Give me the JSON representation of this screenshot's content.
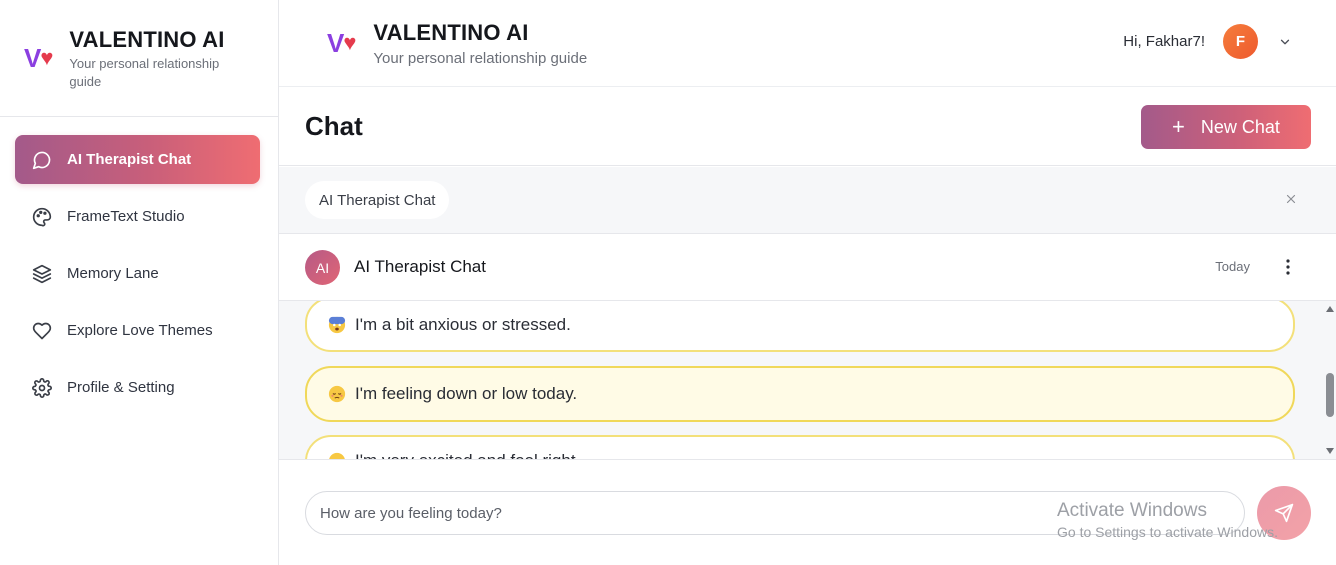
{
  "brand": {
    "logo_v": "V",
    "logo_heart": "♥",
    "title": "VALENTINO AI",
    "subtitle": "Your personal relationship guide"
  },
  "sidebar": {
    "items": [
      {
        "label": "AI Therapist Chat",
        "icon": "chat-bubble-icon",
        "active": true
      },
      {
        "label": "FrameText Studio",
        "icon": "palette-icon",
        "active": false
      },
      {
        "label": "Memory Lane",
        "icon": "layers-icon",
        "active": false
      },
      {
        "label": "Explore Love Themes",
        "icon": "heart-icon",
        "active": false
      },
      {
        "label": "Profile & Setting",
        "icon": "gear-icon",
        "active": false
      }
    ]
  },
  "header": {
    "greeting": "Hi, Fakhar7!",
    "avatar_initial": "F"
  },
  "chat": {
    "title": "Chat",
    "new_chat_label": "New Chat",
    "tab_label": "AI Therapist Chat",
    "conversation": {
      "badge": "AI",
      "title": "AI Therapist Chat",
      "date": "Today"
    },
    "options": [
      {
        "emoji": "anxious-face",
        "text": "I'm a bit anxious or stressed."
      },
      {
        "emoji": "pensive-face",
        "text": "I'm feeling down or low today.",
        "selected": true
      },
      {
        "emoji": "smile-face",
        "text": "I'm very excited and fool right"
      }
    ],
    "input_placeholder": "How are you feeling today?"
  },
  "watermark": {
    "line1": "Activate Windows",
    "line2": "Go to Settings to activate Windows."
  },
  "colors": {
    "accent_start": "#a35a8a",
    "accent_end": "#ef6d72",
    "option_border": "#f3e07a",
    "avatar": "#f26a33"
  }
}
